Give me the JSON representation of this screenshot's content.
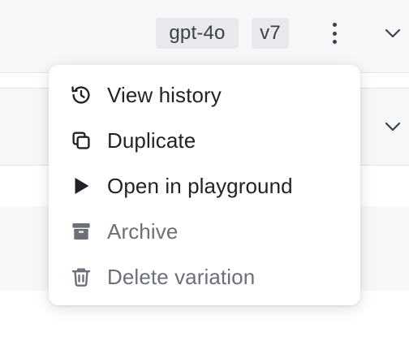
{
  "header": {
    "model_badge": "gpt-4o",
    "version_badge": "v7"
  },
  "menu": {
    "items": [
      {
        "label": "View history",
        "icon": "history-icon",
        "muted": false
      },
      {
        "label": "Duplicate",
        "icon": "duplicate-icon",
        "muted": false
      },
      {
        "label": "Open in playground",
        "icon": "play-icon",
        "muted": false
      },
      {
        "label": "Archive",
        "icon": "archive-icon",
        "muted": true
      },
      {
        "label": "Delete variation",
        "icon": "trash-icon",
        "muted": true
      }
    ]
  },
  "colors": {
    "menu_text": "#1f2328",
    "muted_text": "#6b7078",
    "badge_bg": "#e7e9ec",
    "panel_bg": "#f6f7f8"
  }
}
